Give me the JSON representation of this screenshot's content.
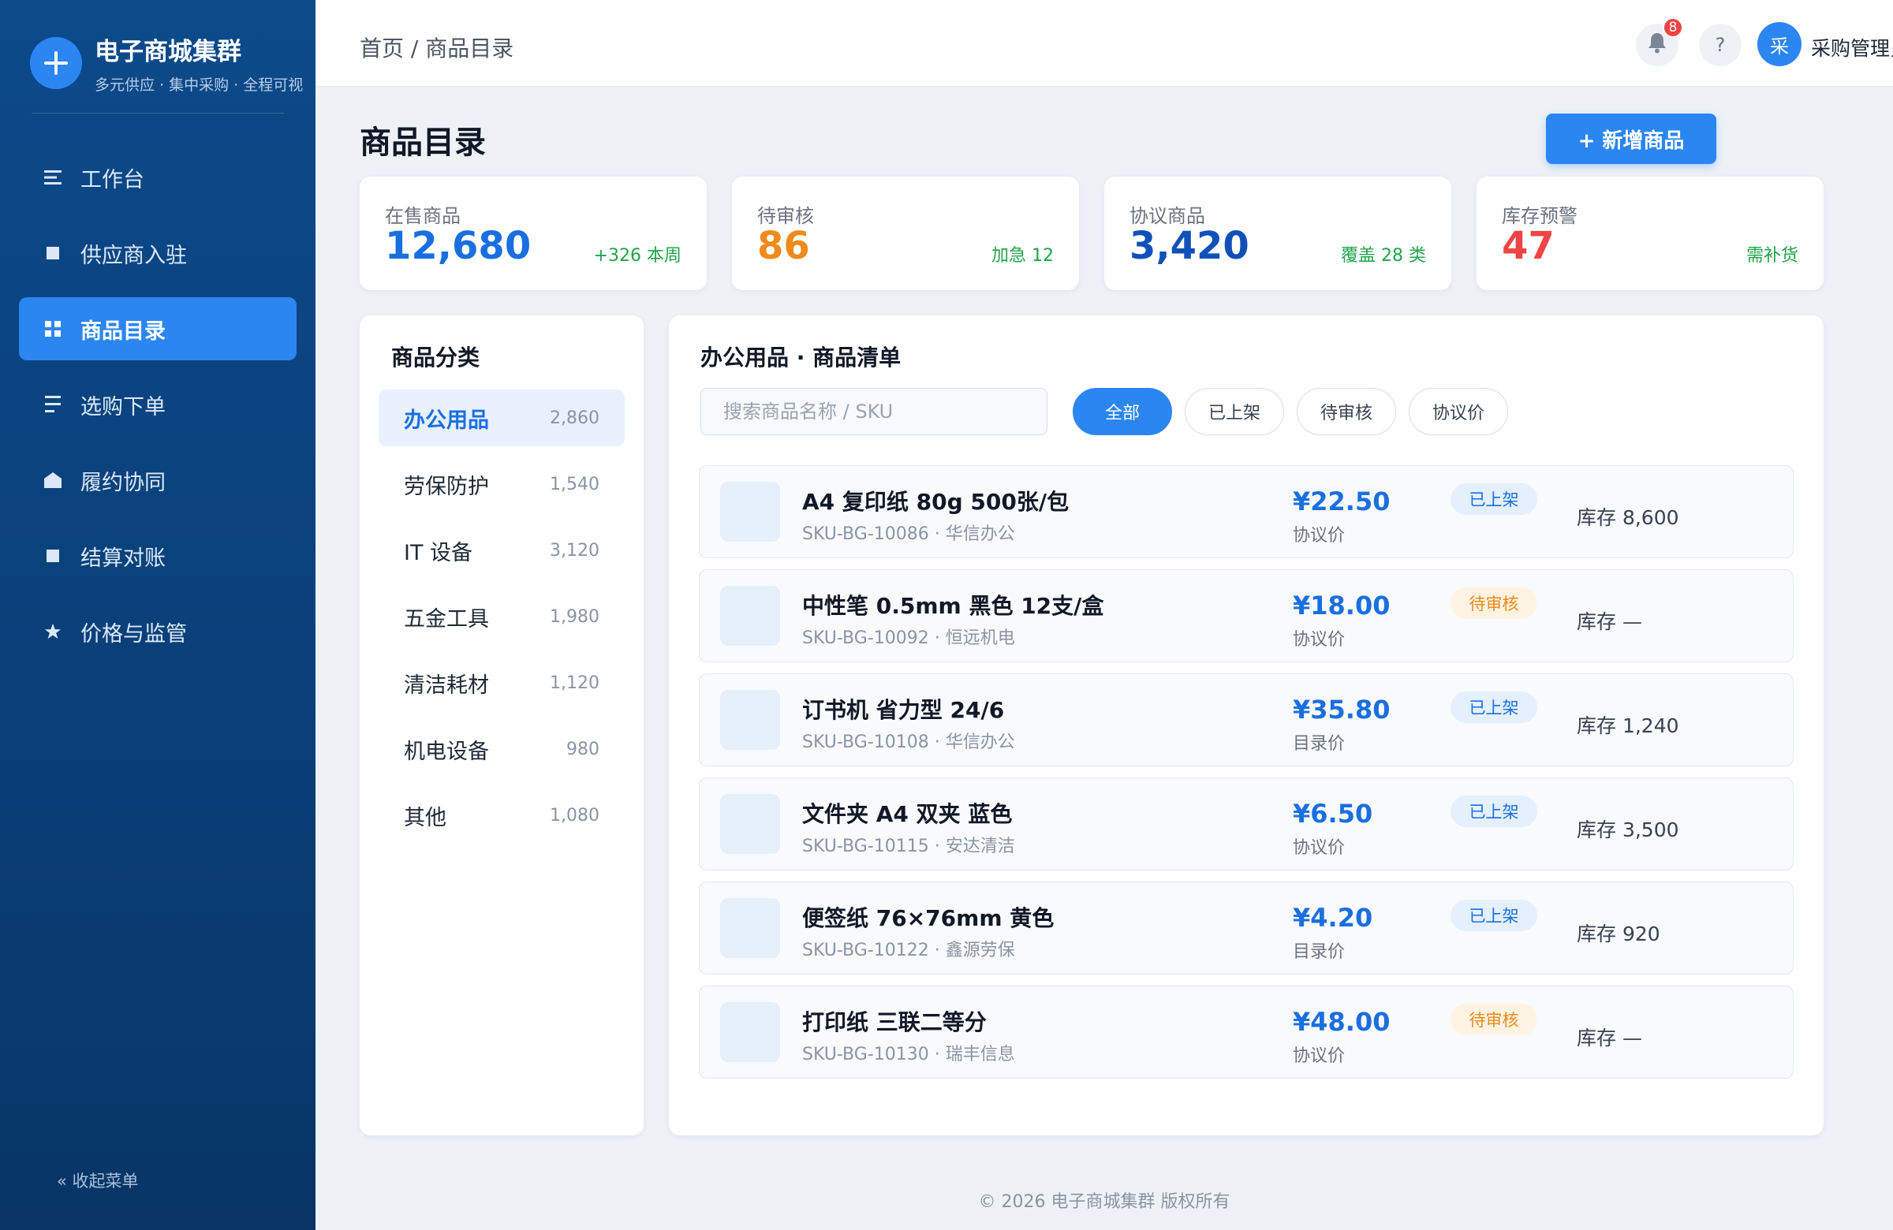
{
  "brand": {
    "title": "电子商城集群",
    "subtitle": "多元供应 · 集中采购 · 全程可视"
  },
  "nav": [
    {
      "label": "工作台",
      "icon": "list-icon",
      "active": false
    },
    {
      "label": "供应商入驻",
      "icon": "square-icon",
      "active": false
    },
    {
      "label": "商品目录",
      "icon": "grid-icon",
      "active": true
    },
    {
      "label": "选购下单",
      "icon": "order-icon",
      "active": false
    },
    {
      "label": "履约协同",
      "icon": "home-icon",
      "active": false
    },
    {
      "label": "结算对账",
      "icon": "square-icon",
      "active": false
    },
    {
      "label": "价格与监管",
      "icon": "star-icon",
      "active": false
    }
  ],
  "collapse_label": "« 收起菜单",
  "topbar": {
    "breadcrumb": "首页 / 商品目录",
    "notification_count": "8",
    "help_label": "?",
    "avatar_initial": "采",
    "user_name": "采购管理员"
  },
  "page": {
    "title": "商品目录",
    "add_button": "+ 新增商品"
  },
  "stats": [
    {
      "label": "在售商品",
      "value": "12,680",
      "note": "+326 本周",
      "color": "#1a6fe0"
    },
    {
      "label": "待审核",
      "value": "86",
      "note": "加急 12",
      "color": "#f08a1a"
    },
    {
      "label": "协议商品",
      "value": "3,420",
      "note": "覆盖 28 类",
      "color": "#1150b8"
    },
    {
      "label": "库存预警",
      "value": "47",
      "note": "需补货",
      "color": "#ef4444"
    }
  ],
  "categories": {
    "title": "商品分类",
    "items": [
      {
        "name": "办公用品",
        "count": "2,860",
        "active": true
      },
      {
        "name": "劳保防护",
        "count": "1,540",
        "active": false
      },
      {
        "name": "IT 设备",
        "count": "3,120",
        "active": false
      },
      {
        "name": "五金工具",
        "count": "1,980",
        "active": false
      },
      {
        "name": "清洁耗材",
        "count": "1,120",
        "active": false
      },
      {
        "name": "机电设备",
        "count": "980",
        "active": false
      },
      {
        "name": "其他",
        "count": "1,080",
        "active": false
      }
    ]
  },
  "list": {
    "title": "办公用品 · 商品清单",
    "search_placeholder": "搜索商品名称 / SKU",
    "filters": [
      {
        "label": "全部",
        "active": true
      },
      {
        "label": "已上架",
        "active": false
      },
      {
        "label": "待审核",
        "active": false
      },
      {
        "label": "协议价",
        "active": false
      }
    ],
    "products": [
      {
        "name": "A4 复印纸 80g 500张/包",
        "sku": "SKU-BG-10086 · 华信办公",
        "price": "¥22.50",
        "price_type": "协议价",
        "status": "已上架",
        "status_kind": "on",
        "stock": "库存 8,600"
      },
      {
        "name": "中性笔 0.5mm 黑色 12支/盒",
        "sku": "SKU-BG-10092 · 恒远机电",
        "price": "¥18.00",
        "price_type": "协议价",
        "status": "待审核",
        "status_kind": "pend",
        "stock": "库存 —"
      },
      {
        "name": "订书机 省力型 24/6",
        "sku": "SKU-BG-10108 · 华信办公",
        "price": "¥35.80",
        "price_type": "目录价",
        "status": "已上架",
        "status_kind": "on",
        "stock": "库存 1,240"
      },
      {
        "name": "文件夹 A4 双夹 蓝色",
        "sku": "SKU-BG-10115 · 安达清洁",
        "price": "¥6.50",
        "price_type": "协议价",
        "status": "已上架",
        "status_kind": "on",
        "stock": "库存 3,500"
      },
      {
        "name": "便签纸 76×76mm 黄色",
        "sku": "SKU-BG-10122 · 鑫源劳保",
        "price": "¥4.20",
        "price_type": "目录价",
        "status": "已上架",
        "status_kind": "on",
        "stock": "库存 920"
      },
      {
        "name": "打印纸 三联二等分",
        "sku": "SKU-BG-10130 · 瑞丰信息",
        "price": "¥48.00",
        "price_type": "协议价",
        "status": "待审核",
        "status_kind": "pend",
        "stock": "库存 —"
      }
    ]
  },
  "footer": "© 2026 电子商城集群 版权所有"
}
